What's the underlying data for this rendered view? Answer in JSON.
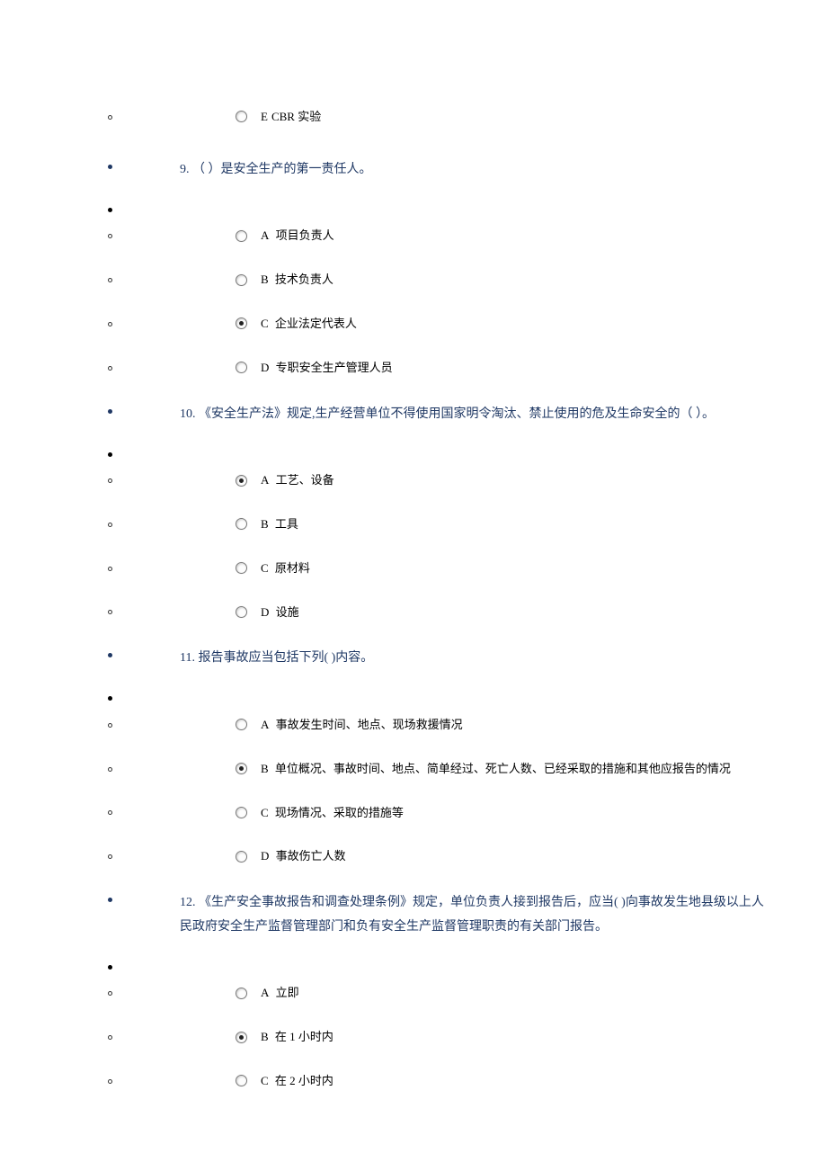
{
  "orphan_option": {
    "letter": "E",
    "text": "CBR 实验",
    "selected": false
  },
  "questions": [
    {
      "number": "9.",
      "text": "（ ）是安全生产的第一责任人。",
      "options": [
        {
          "letter": "A",
          "text": "项目负责人",
          "selected": false
        },
        {
          "letter": "B",
          "text": "技术负责人",
          "selected": false
        },
        {
          "letter": "C",
          "text": "企业法定代表人",
          "selected": true
        },
        {
          "letter": "D",
          "text": "专职安全生产管理人员",
          "selected": false
        }
      ]
    },
    {
      "number": "10.",
      "text": "《安全生产法》规定,生产经营单位不得使用国家明令淘汰、禁止使用的危及生命安全的（ ）。",
      "options": [
        {
          "letter": "A",
          "text": "工艺、设备",
          "selected": true
        },
        {
          "letter": "B",
          "text": "工具",
          "selected": false
        },
        {
          "letter": "C",
          "text": "原材料",
          "selected": false
        },
        {
          "letter": "D",
          "text": "设施",
          "selected": false
        }
      ]
    },
    {
      "number": "11.",
      "text": "报告事故应当包括下列( )内容。",
      "options": [
        {
          "letter": "A",
          "text": "事故发生时间、地点、现场救援情况",
          "selected": false
        },
        {
          "letter": "B",
          "text": "单位概况、事故时间、地点、简单经过、死亡人数、已经采取的措施和其他应报告的情况",
          "selected": true
        },
        {
          "letter": "C",
          "text": "现场情况、采取的措施等",
          "selected": false
        },
        {
          "letter": "D",
          "text": "事故伤亡人数",
          "selected": false
        }
      ]
    },
    {
      "number": "12.",
      "text": "《生产安全事故报告和调查处理条例》规定，单位负责人接到报告后，应当( )向事故发生地县级以上人民政府安全生产监督管理部门和负有安全生产监督管理职责的有关部门报告。",
      "options": [
        {
          "letter": "A",
          "text": "立即",
          "selected": false
        },
        {
          "letter": "B",
          "text": "在 1 小时内",
          "selected": true
        },
        {
          "letter": "C",
          "text": "在 2 小时内",
          "selected": false
        }
      ]
    }
  ]
}
